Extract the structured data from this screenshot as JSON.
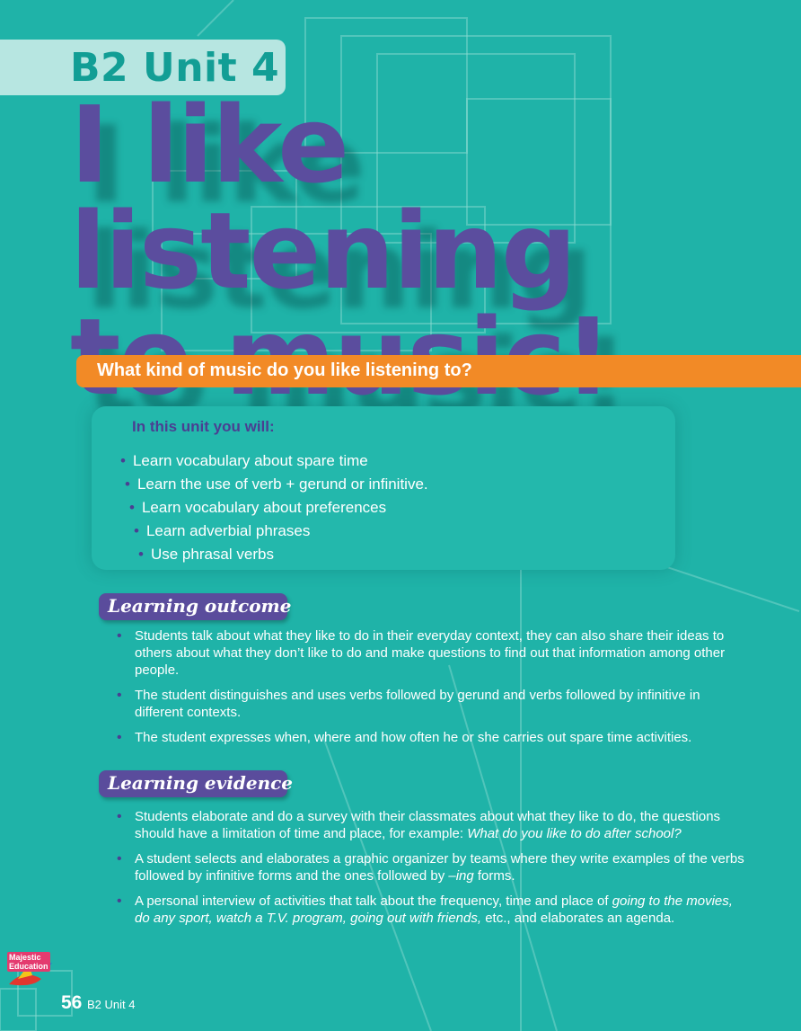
{
  "header": {
    "unit_tab": "B2 Unit 4",
    "title_line1": "I like listening",
    "title_line2": "to music!"
  },
  "question": "What kind of music do you like listening to?",
  "unit_box": {
    "title": "In this unit you will:",
    "items": [
      "Learn vocabulary about spare time",
      "Learn the use of verb + gerund or infinitive.",
      "Learn vocabulary about preferences",
      "Learn adverbial phrases",
      "Use phrasal verbs"
    ]
  },
  "learning_outcome": {
    "heading": "Learning outcome",
    "bullets": [
      "Students talk about what they like to do in their everyday context, they can also share their ideas to others about what they don’t like to do and make questions to find out that information among other people.",
      "The student distinguishes and uses verbs followed by gerund and verbs followed by infinitive in different contexts.",
      "The student expresses when, where and how often he or she carries out spare time activities."
    ]
  },
  "learning_evidence": {
    "heading": "Learning evidence",
    "bullet1_text": "Students elaborate and do a survey with their classmates about what they like to do, the questions should have a limitation of time and place, for example: ",
    "bullet1_italic": "What do you like to do after school?",
    "bullet2_a": "A student selects and elaborates a graphic organizer by teams where they write examples of the verbs followed by infinitive forms and the ones followed by ",
    "bullet2_italic": "–ing",
    "bullet2_b": " forms.",
    "bullet3_a": "A personal interview of activities that talk about the frequency, time and place of ",
    "bullet3_italic": "going to the movies, do any sport, watch a T.V. program, going out with friends,",
    "bullet3_b": " etc., and elaborates an agenda."
  },
  "footer": {
    "logo_text_1": "Majestic",
    "logo_text_2": "Education",
    "page_number": "56",
    "unit_label": "B2 Unit 4"
  },
  "colors": {
    "background": "#1fb3a8",
    "title_purple": "#5b4d9e",
    "orange_bar": "#f28a26",
    "tab_light": "#b7e6e1"
  }
}
